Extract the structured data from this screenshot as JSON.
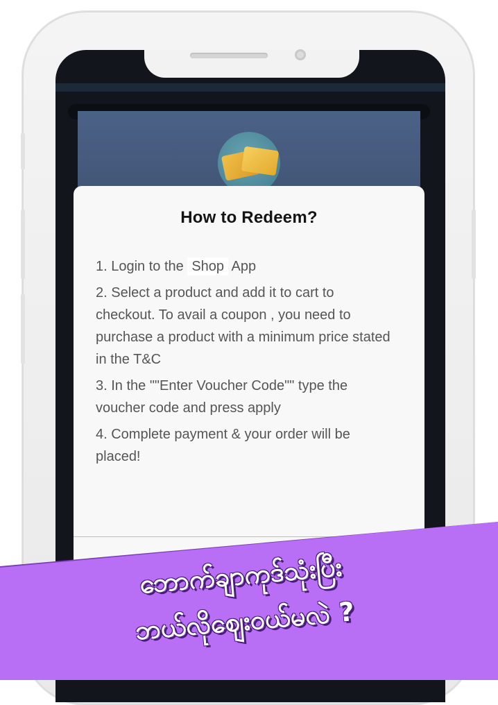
{
  "modal": {
    "title": "How to Redeem?",
    "steps": {
      "step1_prefix": "1. Login to the",
      "step1_app": "Shop",
      "step1_suffix": "App",
      "step2": "2. Select a product and add it to cart to checkout. To avail a coupon , you need to purchase a product with a minimum price stated in the T&C",
      "step3": "3. In the \"\"Enter Voucher Code\"\" type the voucher code and press apply",
      "step4": "4. Complete payment & your order will be placed!"
    }
  },
  "banner": {
    "line1": "ဘောက်ချာကုဒ်သုံးပြီး",
    "line2": "ဘယ်လိုဈေးဝယ်မလဲ ?",
    "color": "#b86ef5"
  },
  "icons": {
    "coupon": "coupon-ticket-icon"
  }
}
